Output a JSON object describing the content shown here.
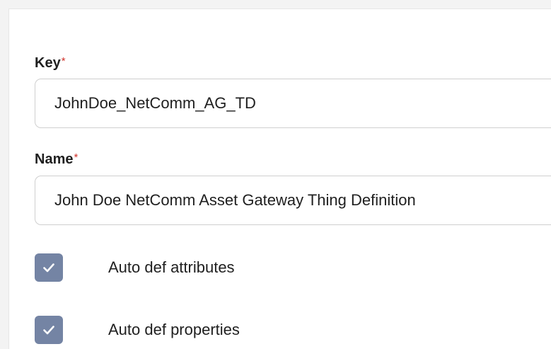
{
  "form": {
    "key": {
      "label": "Key",
      "required_mark": "*",
      "value": "JohnDoe_NetComm_AG_TD"
    },
    "name": {
      "label": "Name",
      "required_mark": "*",
      "value": "John Doe NetComm Asset Gateway Thing Definition"
    },
    "checkboxes": [
      {
        "label": "Auto def attributes",
        "checked": true,
        "icon": "check-icon"
      },
      {
        "label": "Auto def properties",
        "checked": true,
        "icon": "check-icon"
      }
    ]
  },
  "colors": {
    "checkbox_fill": "#7484a4",
    "required_mark": "#d0342c",
    "input_border": "#cfcfcf"
  }
}
